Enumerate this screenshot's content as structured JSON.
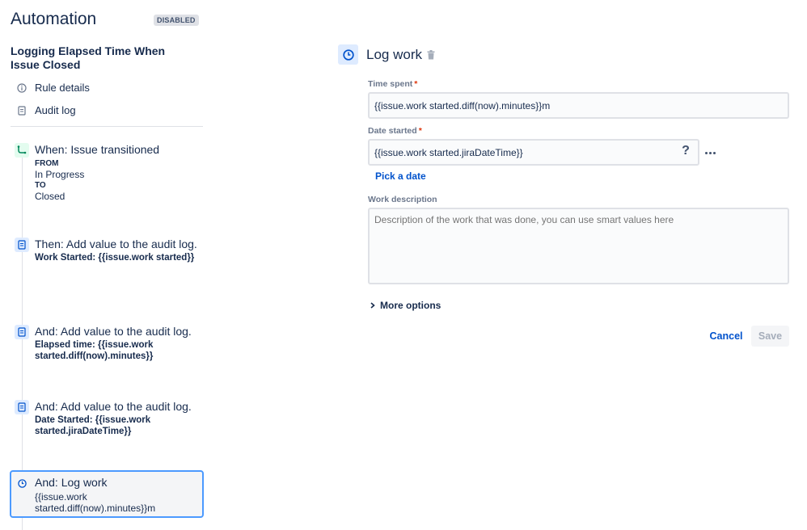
{
  "app": {
    "title": "Automation",
    "status_badge": "DISABLED"
  },
  "rule": {
    "name": "Logging Elapsed Time When Issue Closed"
  },
  "nav": [
    {
      "label": "Rule details",
      "icon": "info-icon"
    },
    {
      "label": "Audit log",
      "icon": "document-icon"
    }
  ],
  "steps": [
    {
      "title": "When: Issue transitioned",
      "icon": "transition-icon",
      "from_label": "FROM",
      "from_value": "In Progress",
      "to_label": "TO",
      "to_value": "Closed"
    },
    {
      "title": "Then: Add value to the audit log.",
      "icon": "audit-log-icon",
      "detail": "Work Started: {{issue.work started}}"
    },
    {
      "title": "And: Add value to the audit log.",
      "icon": "audit-log-icon",
      "detail": "Elapsed time: {{issue.work started.diff(now).minutes}}"
    },
    {
      "title": "And: Add value to the audit log.",
      "icon": "audit-log-icon",
      "detail": "Date Started: {{issue.work started.jiraDateTime}}"
    },
    {
      "title": "And: Log work",
      "icon": "clock-icon",
      "detail": "{{issue.work started.diff(now).minutes}}m",
      "selected": true
    }
  ],
  "panel": {
    "title": "Log work",
    "icon": "clock-icon",
    "time_spent": {
      "label": "Time spent",
      "required_marker": "*",
      "value": "{{issue.work started.diff(now).minutes}}m"
    },
    "date_started": {
      "label": "Date started",
      "required_marker": "*",
      "value": "{{issue.work started.jiraDateTime}}",
      "help": "?",
      "link": "Pick a date"
    },
    "work_description": {
      "label": "Work description",
      "placeholder": "Description of the work that was done, you can use smart values here",
      "value": ""
    },
    "more_options": "More options",
    "cancel": "Cancel",
    "save": "Save"
  },
  "colors": {
    "text": "#172b4d",
    "subtle": "#6b778c",
    "link": "#0052cc",
    "trigger_bg": "#e3fcef",
    "action_bg": "#deebff",
    "selected_border": "#4c9aff",
    "required": "#de350b"
  }
}
